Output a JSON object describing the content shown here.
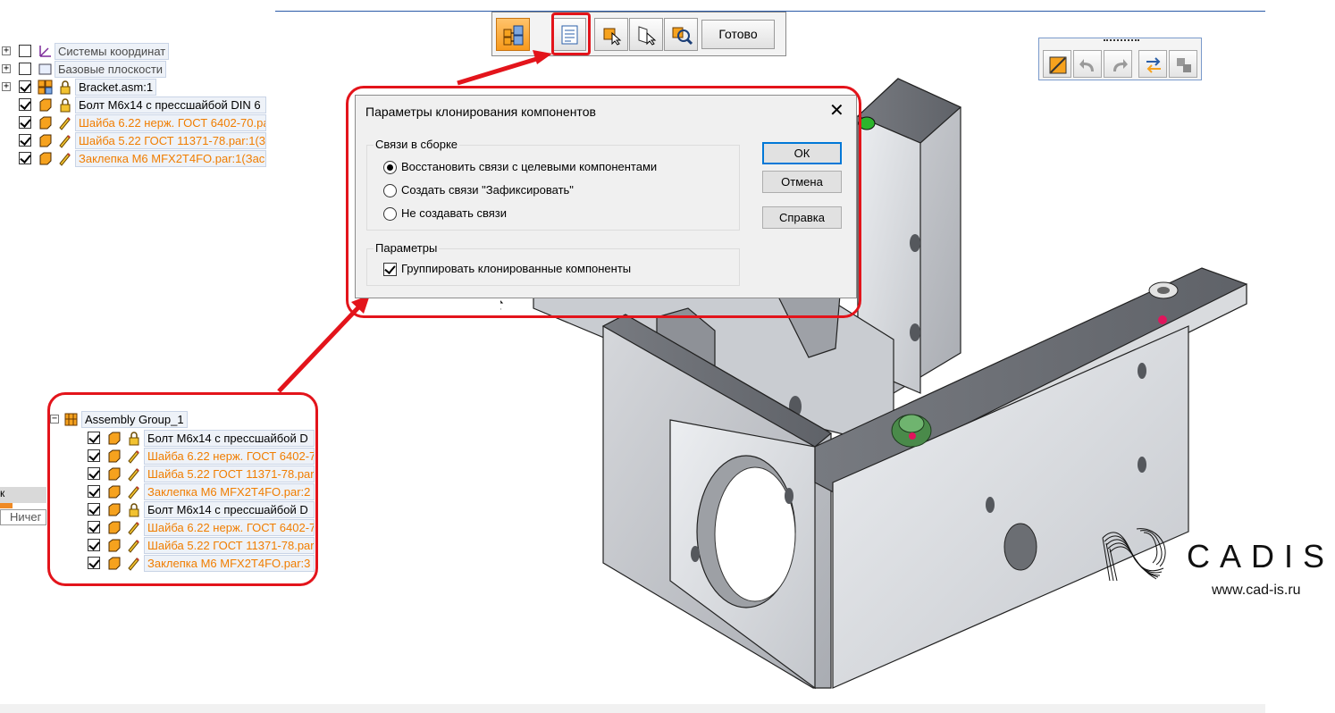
{
  "top_toolbar": {
    "done_label": "Готово",
    "buttons": [
      "clone-components-icon",
      "properties-list-icon",
      "select-component-icon",
      "select-face-icon",
      "zoom-search-icon"
    ]
  },
  "right_toolbar": {
    "buttons": [
      "sketch-icon",
      "undo-icon",
      "redo-icon",
      "swap-icon",
      "assembly-icon"
    ]
  },
  "tree": {
    "items": [
      {
        "label": "Системы координат"
      },
      {
        "label": "Базовые плоскости"
      },
      {
        "label": "Bracket.asm:1"
      },
      {
        "label": "Болт М6х14 с прессшайбой DIN 6"
      },
      {
        "label": "Шайба 6.22 нерж. ГОСТ 6402-70.par"
      },
      {
        "label": "Шайба 5.22 ГОСТ 11371-78.par:1(3"
      },
      {
        "label": "Заклепка М6 MFX2T4FO.par:1(Зас"
      }
    ]
  },
  "dialog": {
    "title": "Параметры клонирования компонентов",
    "close": "✕",
    "group1_title": "Связи в сборке",
    "radio1": "Восстановить связи с целевыми компонентами",
    "radio2": "Создать связи \"Зафиксировать\"",
    "radio3": "Не создавать связи",
    "group2_title": "Параметры",
    "checkbox1": "Группировать клонированные компоненты",
    "ok": "ОК",
    "cancel": "Отмена",
    "help": "Справка"
  },
  "group_tree": {
    "root": "Assembly Group_1",
    "items": [
      {
        "label": "Болт М6х14 с прессшайбой D"
      },
      {
        "label": "Шайба 6.22 нерж. ГОСТ 6402-7"
      },
      {
        "label": "Шайба 5.22 ГОСТ 11371-78.par"
      },
      {
        "label": "Заклепка М6 MFX2T4FO.par:2"
      },
      {
        "label": "Болт М6х14 с прессшайбой D"
      },
      {
        "label": "Шайба 6.22 нерж. ГОСТ 6402-7"
      },
      {
        "label": "Шайба 5.22 ГОСТ 11371-78.par"
      },
      {
        "label": "Заклепка М6 MFX2T4FO.par:3"
      }
    ]
  },
  "left_fragment": {
    "tab": "к",
    "field": "Ничег"
  },
  "logo": {
    "name": "CADIS",
    "url": "www.cad-is.ru"
  },
  "colors": {
    "highlight": "#e3141b",
    "orange_text": "#f07d00",
    "accent_blue": "#0078d7"
  }
}
